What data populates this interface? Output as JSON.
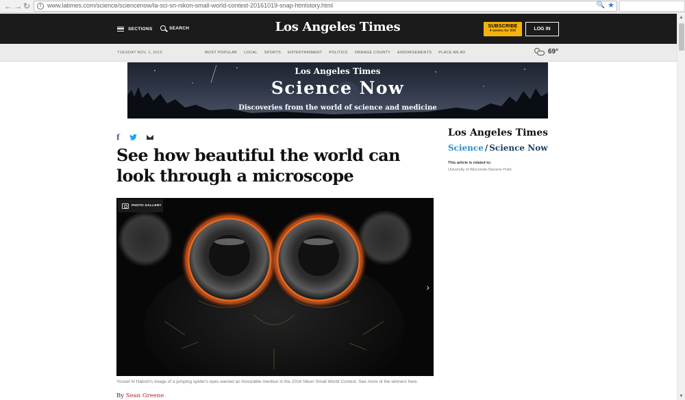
{
  "browser": {
    "url": "www.latimes.com/science/sciencenow/la-sci-sn-nikon-small-world-contest-20161019-snap-htmlstory.html"
  },
  "header": {
    "brand": "Los Angeles Times",
    "sections_label": "SECTIONS",
    "search_label": "SEARCH",
    "subscribe_label": "SUBSCRIBE",
    "subscribe_offer": "4 weeks for 99¢",
    "login_label": "LOG IN",
    "background_color": "#1b1b1b",
    "subscribe_color": "#f6b20e"
  },
  "subnav": {
    "date": "TUESDAY NOV. 1, 2016",
    "links": [
      "MOST POPULAR",
      "LOCAL",
      "SPORTS",
      "ENTERTAINMENT",
      "POLITICS",
      "ORANGE COUNTY",
      "ENDORSEMENTS",
      "PLACE AN AD"
    ],
    "weather_temp": "69°",
    "weather_icon": "partly-cloudy-icon"
  },
  "banner": {
    "brand": "Los Angeles Times",
    "title": "Science Now",
    "subtitle": "Discoveries from the world of science and medicine"
  },
  "article": {
    "share": {
      "facebook": "f",
      "facebook_icon": "facebook-icon",
      "twitter_icon": "twitter-icon",
      "email_icon": "email-icon"
    },
    "headline": "See how beautiful the world can look through a microscope",
    "gallery_label": "PHOTO GALLERY",
    "caption": "Yousef Al Habshi's image of a jumping spider's eyes earned an honorable mention in the 2016 Nikon Small World Contest. See more of the winners here.",
    "byline_prefix": "By",
    "author": "Sean Greene"
  },
  "sidebar": {
    "brand": "Los Angeles Times",
    "section": "Science",
    "separator": "/",
    "subsection": "Science Now",
    "related_label": "This article is related to:",
    "related_value": "University of Wisconsin-Stevens Point"
  }
}
